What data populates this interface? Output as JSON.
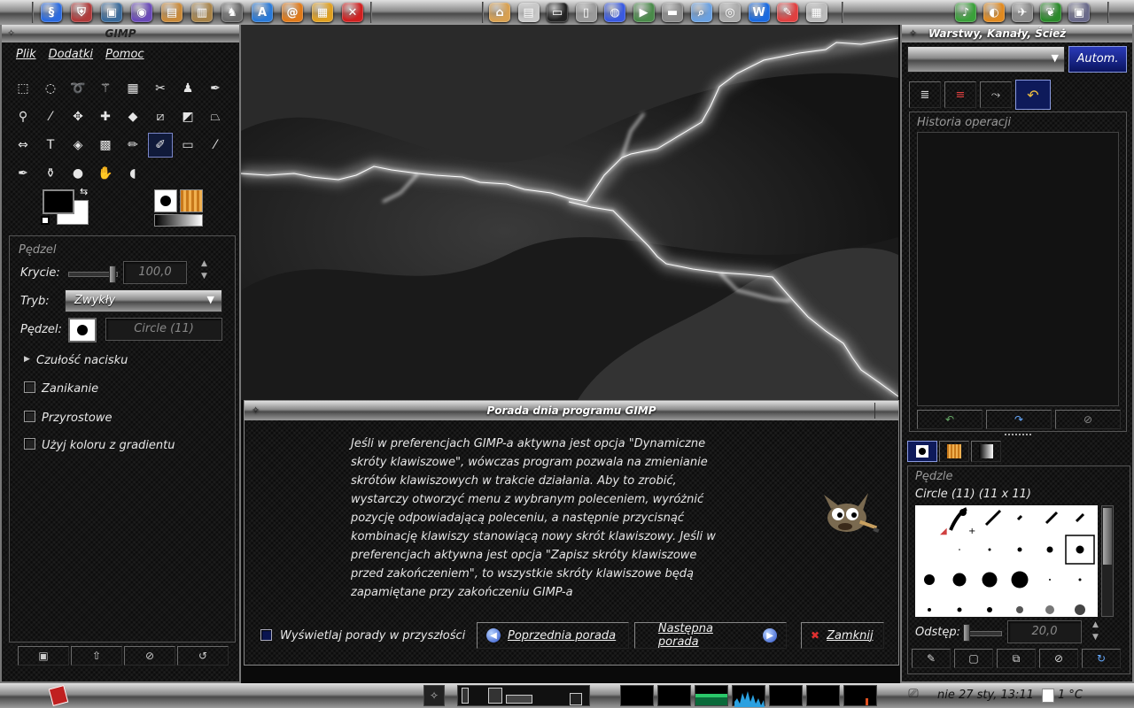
{
  "top_panel": {
    "left_launchers": [
      {
        "icon": "debian-swirl-icon",
        "color": "#2b6be0",
        "glyph": "§"
      },
      {
        "icon": "shield-icon",
        "color": "#b03a3a",
        "glyph": "⛨"
      },
      {
        "icon": "monitor-icon",
        "color": "#3a6a9a",
        "glyph": "▣"
      },
      {
        "icon": "disc-icon",
        "color": "#6a4ab8",
        "glyph": "◉"
      },
      {
        "icon": "package-icon",
        "color": "#c98a3a",
        "glyph": "▤"
      },
      {
        "icon": "package-manager-icon",
        "color": "#a8844a",
        "glyph": "▥"
      },
      {
        "icon": "gnu-icon",
        "color": "#6a6a6a",
        "glyph": "♞"
      },
      {
        "icon": "text-editor-icon",
        "color": "#2a7ad8",
        "glyph": "A"
      },
      {
        "icon": "swirl-icon",
        "color": "#e07a1a",
        "glyph": "@"
      },
      {
        "icon": "gift-box-icon",
        "color": "#e0a020",
        "glyph": "▦"
      },
      {
        "icon": "close-app-icon",
        "color": "#d02020",
        "glyph": "✕"
      }
    ],
    "center_launchers": [
      {
        "icon": "home-icon",
        "color": "#d8a050",
        "glyph": "⌂"
      },
      {
        "icon": "documents-icon",
        "color": "#c8c8c8",
        "glyph": "▤"
      },
      {
        "icon": "terminal-icon",
        "color": "#222222",
        "glyph": "▭"
      },
      {
        "icon": "trash-icon",
        "color": "#9a9a9a",
        "glyph": "▯"
      },
      {
        "icon": "network-icon",
        "color": "#3a5ae0",
        "glyph": "◍"
      },
      {
        "icon": "media-player-icon",
        "color": "#4a8a4a",
        "glyph": "▶"
      },
      {
        "icon": "drive-icon",
        "color": "#8a8a8a",
        "glyph": "▬"
      },
      {
        "icon": "search-files-icon",
        "color": "#6aa0e0",
        "glyph": "⌕"
      },
      {
        "icon": "scanner-icon",
        "color": "#aaaaaa",
        "glyph": "◎"
      },
      {
        "icon": "wordprocessor-icon",
        "color": "#1a6ae0",
        "glyph": "W"
      },
      {
        "icon": "notes-icon",
        "color": "#e04040",
        "glyph": "✎"
      },
      {
        "icon": "calculator-icon",
        "color": "#bbbbbb",
        "glyph": "▦"
      }
    ],
    "right_launchers": [
      {
        "icon": "music-icon",
        "color": "#3aa03a",
        "glyph": "♪"
      },
      {
        "icon": "blender-icon",
        "color": "#e08a20",
        "glyph": "◐"
      },
      {
        "icon": "game-icon",
        "color": "#8a8a8a",
        "glyph": "✈"
      },
      {
        "icon": "leaf-icon",
        "color": "#2a8a2a",
        "glyph": "❦"
      },
      {
        "icon": "windows-icon",
        "color": "#6a6a8a",
        "glyph": "▣"
      }
    ]
  },
  "toolbox": {
    "title": "GIMP",
    "menu": [
      "Plik",
      "Dodatki",
      "Pomoc"
    ],
    "tools": [
      {
        "name": "rect-select-icon",
        "glyph": "⬚"
      },
      {
        "name": "ellipse-select-icon",
        "glyph": "◌"
      },
      {
        "name": "lasso-icon",
        "glyph": "➰"
      },
      {
        "name": "fuzzy-select-icon",
        "glyph": "⚚"
      },
      {
        "name": "color-select-icon",
        "glyph": "▦"
      },
      {
        "name": "scissors-icon",
        "glyph": "✂"
      },
      {
        "name": "foreground-select-icon",
        "glyph": "♟"
      },
      {
        "name": "paths-icon",
        "glyph": "✒"
      },
      {
        "name": "color-picker-icon",
        "glyph": "⚲"
      },
      {
        "name": "zoom-icon",
        "glyph": "⁄"
      },
      {
        "name": "measure-icon",
        "glyph": "✥"
      },
      {
        "name": "move-icon",
        "glyph": "✚"
      },
      {
        "name": "align-icon",
        "glyph": "◆"
      },
      {
        "name": "crop-icon",
        "glyph": "⧄"
      },
      {
        "name": "rotate-icon",
        "glyph": "◩"
      },
      {
        "name": "scale-icon",
        "glyph": "⏢"
      },
      {
        "name": "flip-icon",
        "glyph": "⇔"
      },
      {
        "name": "text-icon",
        "glyph": "T"
      },
      {
        "name": "bucket-fill-icon",
        "glyph": "◈"
      },
      {
        "name": "blend-icon",
        "glyph": "▩"
      },
      {
        "name": "pencil-icon",
        "glyph": "✏"
      },
      {
        "name": "paintbrush-icon",
        "glyph": "✐"
      },
      {
        "name": "eraser-icon",
        "glyph": "▭"
      },
      {
        "name": "airbrush-icon",
        "glyph": "⁄"
      },
      {
        "name": "ink-icon",
        "glyph": "✒"
      },
      {
        "name": "clone-icon",
        "glyph": "⚱"
      },
      {
        "name": "blur-icon",
        "glyph": "●"
      },
      {
        "name": "smudge-icon",
        "glyph": "✋"
      },
      {
        "name": "dodge-burn-icon",
        "glyph": "◖"
      }
    ],
    "active_tool_index": 21,
    "fg_color": "#000000",
    "bg_color": "#ffffff",
    "options": {
      "title": "Pędzel",
      "opacity_label": "Krycie:",
      "opacity_value": "100,0",
      "mode_label": "Tryb:",
      "mode_value": "Zwykły",
      "brush_label": "Pędzel:",
      "brush_value": "Circle (11)",
      "pressure_label": "Czułość nacisku",
      "fade_label": "Zanikanie",
      "incremental_label": "Przyrostowe",
      "gradient_label": "Użyj koloru z gradientu"
    }
  },
  "tip": {
    "title": "Porada dnia programu GIMP",
    "text": "Jeśli w preferencjach GIMP-a aktywna jest opcja \"Dynamiczne\nskróty klawiszowe\", wówczas program pozwala na zmienianie\nskrótów klawiszowych w trakcie działania. Aby to zrobić,\nwystarczy otworzyć menu z wybranym poleceniem, wyróżnić\npozycję odpowiadającą poleceniu, a następnie przycisnąć\nkombinację klawiszy stanowiącą nowy skrót klawiszowy. Jeśli w\npreferencjach aktywna jest opcja \"Zapisz skróty klawiszowe\nprzed zakończeniem\", to wszystkie skróty klawiszowe będą\nzapamiętane przy zakończeniu GIMP-a",
    "show_label": "Wyświetlaj porady w przyszłości",
    "prev_label": "Poprzednia porada",
    "next_label": "Następna porada",
    "close_label": "Zamknij"
  },
  "dock": {
    "title": "Warstwy, Kanały, Ścież",
    "auto_label": "Autom.",
    "history_title": "Historia operacji",
    "brushes_title": "Pędzle",
    "brush_info": "Circle (11) (11 x 11)",
    "spacing_label": "Odstęp:",
    "spacing_value": "20,0"
  },
  "bottom_panel": {
    "clock": "nie 27 sty, 13:11",
    "temperature": "1 °C"
  }
}
